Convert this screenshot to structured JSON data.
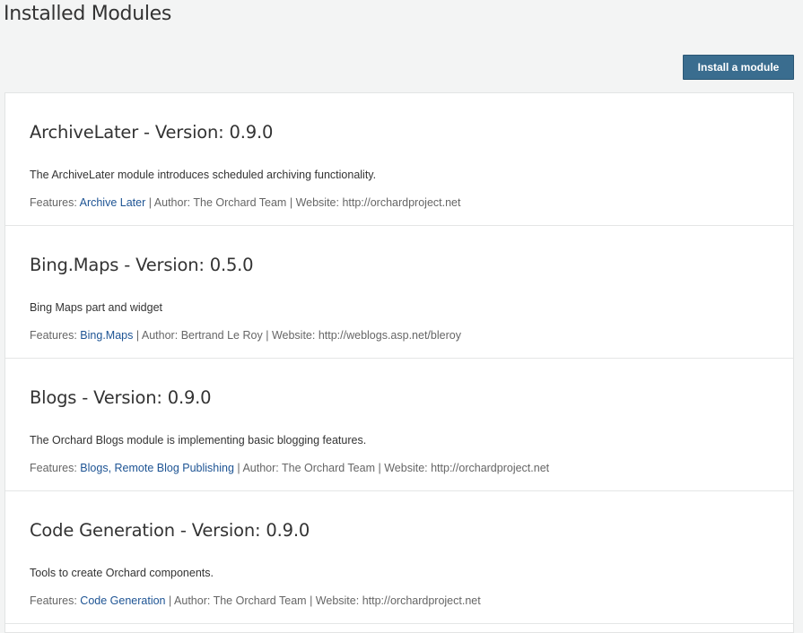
{
  "page": {
    "title": "Installed Modules",
    "install_button_label": "Install a module"
  },
  "colors": {
    "button": "#3a6d8f",
    "link": "#1e5494",
    "background": "#f3f4f4"
  },
  "labels": {
    "features": "Features:",
    "author": "Author:",
    "website": "Website:",
    "separator": "|"
  },
  "modules": [
    {
      "title": "ArchiveLater - Version: 0.9.0",
      "description": "The ArchiveLater module introduces scheduled archiving functionality.",
      "features": "Archive Later",
      "author": "The Orchard Team",
      "website": "http://orchardproject.net"
    },
    {
      "title": "Bing.Maps - Version: 0.5.0",
      "description": "Bing Maps part and widget",
      "features": "Bing.Maps",
      "author": "Bertrand Le Roy",
      "website": "http://weblogs.asp.net/bleroy"
    },
    {
      "title": "Blogs - Version: 0.9.0",
      "description": "The Orchard Blogs module is implementing basic blogging features.",
      "features": "Blogs, Remote Blog Publishing",
      "author": "The Orchard Team",
      "website": "http://orchardproject.net"
    },
    {
      "title": "Code Generation - Version: 0.9.0",
      "description": "Tools to create Orchard components.",
      "features": "Code Generation",
      "author": "The Orchard Team",
      "website": "http://orchardproject.net"
    }
  ]
}
